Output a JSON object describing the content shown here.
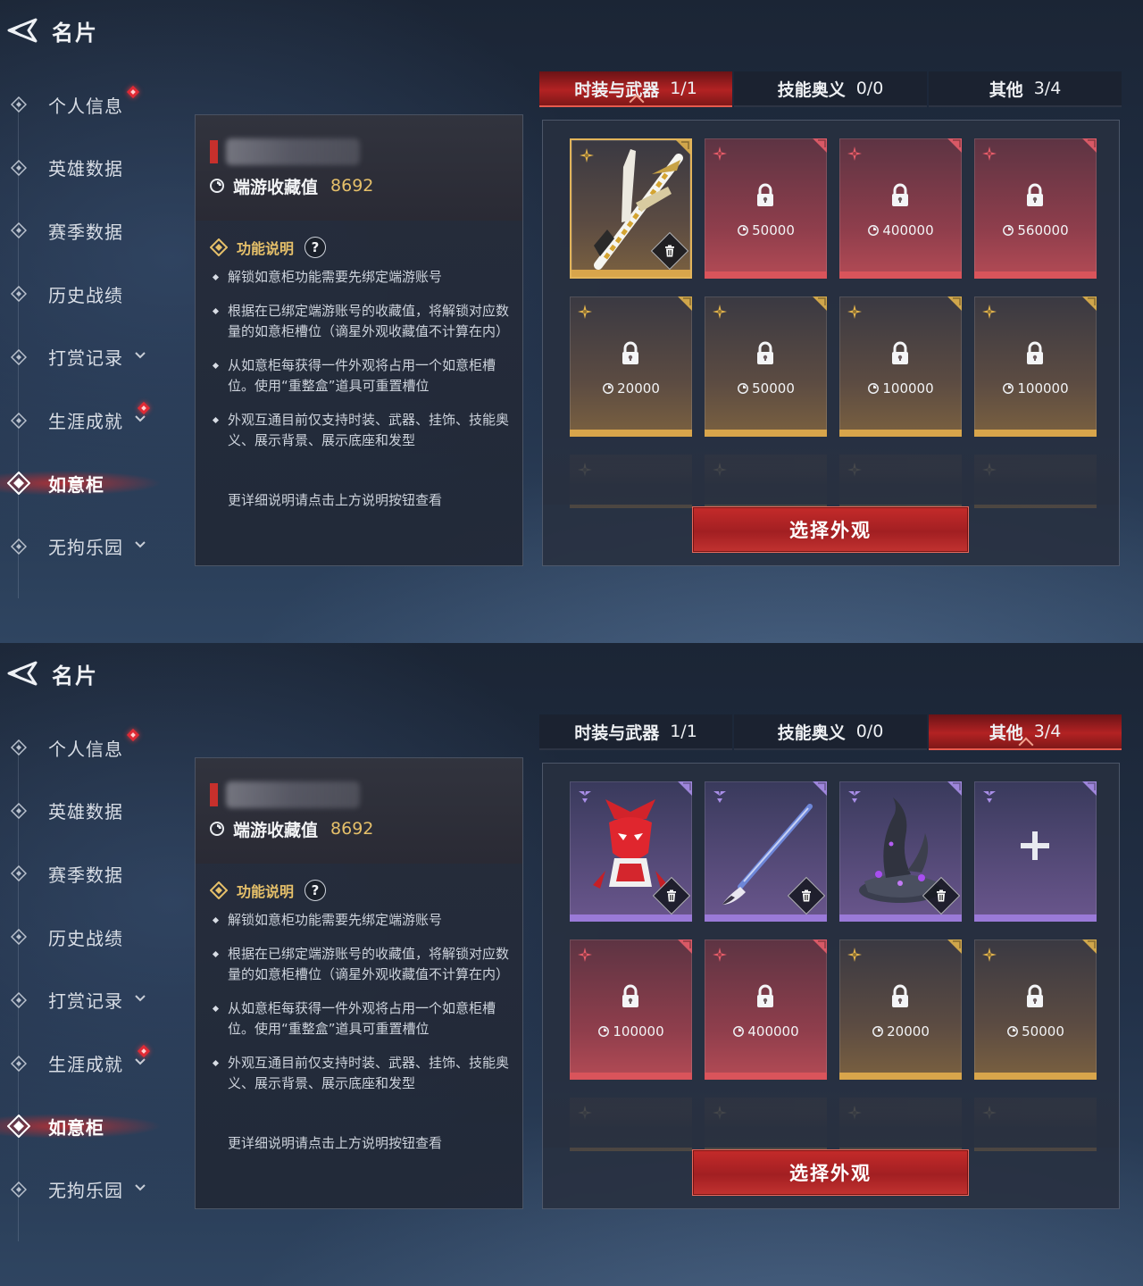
{
  "colors": {
    "accent_red": "#c42b2a",
    "gold_text": "#e6c06a",
    "rarity_gold": "#d8a54b",
    "rarity_red": "#d9545b",
    "rarity_purple": "#9a7ad8"
  },
  "header": {
    "title": "名片",
    "back_icon": "back-arrow-icon"
  },
  "sidebar": {
    "items": [
      {
        "label": "个人信息",
        "has_dot": true,
        "has_chevron": false
      },
      {
        "label": "英雄数据",
        "has_dot": false,
        "has_chevron": false
      },
      {
        "label": "赛季数据",
        "has_dot": false,
        "has_chevron": false
      },
      {
        "label": "历史战绩",
        "has_dot": false,
        "has_chevron": false
      },
      {
        "label": "打赏记录",
        "has_dot": false,
        "has_chevron": true
      },
      {
        "label": "生涯成就",
        "has_dot": true,
        "has_chevron": true
      },
      {
        "label": "如意柜",
        "has_dot": false,
        "has_chevron": false,
        "active": true
      },
      {
        "label": "无拘乐园",
        "has_dot": false,
        "has_chevron": true
      }
    ]
  },
  "info": {
    "collect_label": "端游收藏值",
    "collect_value": "8692",
    "func_title": "功能说明",
    "help_label": "?",
    "bullets": [
      "解锁如意柜功能需要先绑定端游账号",
      "根据在已绑定端游账号的收藏值，将解锁对应数量的如意柜槽位（谪星外观收藏值不计算在内）",
      "从如意柜每获得一件外观将占用一个如意柜槽位。使用“重整盒”道具可重置槽位",
      "外观互通目前仅支持时装、武器、挂饰、技能奥义、展示背景、展示底座和发型"
    ],
    "more_note": "更详细说明请点击上方说明按钮查看"
  },
  "tabs": [
    {
      "label": "时装与武器",
      "count": "1/1"
    },
    {
      "label": "技能奥义",
      "count": "0/0"
    },
    {
      "label": "其他",
      "count": "3/4"
    }
  ],
  "select_button": "选择外观",
  "screens": [
    {
      "active_tab": 0,
      "cards": [
        {
          "rarity": "gold",
          "state": "equipped",
          "item": "weapon-art",
          "cost": ""
        },
        {
          "rarity": "red",
          "state": "locked",
          "cost": "50000"
        },
        {
          "rarity": "red",
          "state": "locked",
          "cost": "400000"
        },
        {
          "rarity": "red",
          "state": "locked",
          "cost": "560000"
        },
        {
          "rarity": "gold",
          "state": "locked",
          "cost": "20000"
        },
        {
          "rarity": "gold",
          "state": "locked",
          "cost": "50000"
        },
        {
          "rarity": "gold",
          "state": "locked",
          "cost": "100000"
        },
        {
          "rarity": "gold",
          "state": "locked",
          "cost": "100000"
        }
      ]
    },
    {
      "active_tab": 2,
      "cards": [
        {
          "rarity": "purple",
          "state": "equipped",
          "item": "mask-art",
          "cost": ""
        },
        {
          "rarity": "purple",
          "state": "equipped",
          "item": "brush-art",
          "cost": ""
        },
        {
          "rarity": "purple",
          "state": "equipped",
          "item": "pedestal-art",
          "cost": ""
        },
        {
          "rarity": "purple",
          "state": "empty",
          "cost": ""
        },
        {
          "rarity": "red",
          "state": "locked",
          "cost": "100000"
        },
        {
          "rarity": "red",
          "state": "locked",
          "cost": "400000"
        },
        {
          "rarity": "gold",
          "state": "locked",
          "cost": "20000"
        },
        {
          "rarity": "gold",
          "state": "locked",
          "cost": "50000"
        }
      ]
    }
  ]
}
